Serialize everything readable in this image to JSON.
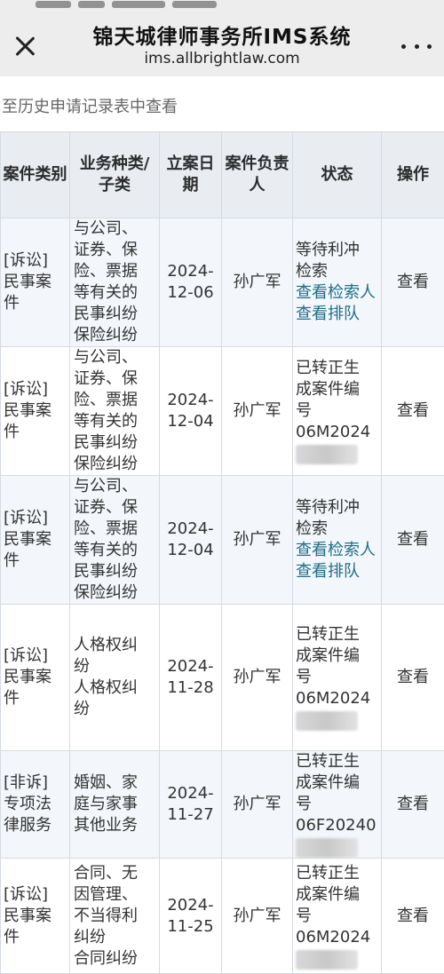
{
  "header": {
    "title": "锦天城律师事务所IMS系统",
    "url": "ims.allbrightlaw.com"
  },
  "notice": "至历史申请记录表中查看",
  "table": {
    "headers": [
      "案件类别",
      "业务种类/子类",
      "立案日期",
      "案件负责人",
      "状态",
      "操作"
    ],
    "rows": [
      {
        "category": [
          "[诉讼]",
          "民事案件"
        ],
        "business": [
          "与公司、",
          "证券、保",
          "险、票据",
          "等有关的",
          "民事纠纷",
          "保险纠纷"
        ],
        "date": [
          "2024-",
          "12-06"
        ],
        "owner": "孙广军",
        "status": [
          "等待利冲",
          "检索"
        ],
        "links": [
          "查看检索人",
          "查看排队"
        ],
        "action": "查看"
      },
      {
        "category": [
          "[诉讼]",
          "民事案件"
        ],
        "business": [
          "与公司、",
          "证券、保",
          "险、票据",
          "等有关的",
          "民事纠纷",
          "保险纠纷"
        ],
        "date": [
          "2024-",
          "12-04"
        ],
        "owner": "孙广军",
        "status": [
          "已转正生",
          "成案件编",
          "号",
          "06M2024"
        ],
        "links": [],
        "action": "查看"
      },
      {
        "category": [
          "[诉讼]",
          "民事案件"
        ],
        "business": [
          "与公司、",
          "证券、保",
          "险、票据",
          "等有关的",
          "民事纠纷",
          "保险纠纷"
        ],
        "date": [
          "2024-",
          "12-04"
        ],
        "owner": "孙广军",
        "status": [
          "等待利冲",
          "检索"
        ],
        "links": [
          "查看检索人",
          "查看排队"
        ],
        "action": "查看"
      },
      {
        "category": [
          "[诉讼]",
          "民事案件"
        ],
        "business": [
          "人格权纠",
          "纷",
          "人格权纠",
          "纷"
        ],
        "date": [
          "2024-",
          "11-28"
        ],
        "owner": "孙广军",
        "status": [
          "已转正生",
          "成案件编",
          "号",
          "06M2024"
        ],
        "links": [],
        "action": "查看"
      },
      {
        "category": [
          "[非诉]",
          "专项法律服务"
        ],
        "business": [
          "婚姻、家",
          "庭与家事",
          "其他业务"
        ],
        "date": [
          "2024-",
          "11-27"
        ],
        "owner": "孙广军",
        "status": [
          "已转正生",
          "成案件编",
          "号",
          "06F20240"
        ],
        "links": [],
        "action": "查看"
      },
      {
        "category": [
          "[诉讼]",
          "民事案件"
        ],
        "business": [
          "合同、无",
          "因管理、",
          "不当得利",
          "纠纷",
          "合同纠纷"
        ],
        "date": [
          "2024-",
          "11-25"
        ],
        "owner": "孙广军",
        "status": [
          "已转正生",
          "成案件编",
          "号",
          "06M2024"
        ],
        "links": [],
        "action": "查看"
      }
    ]
  }
}
